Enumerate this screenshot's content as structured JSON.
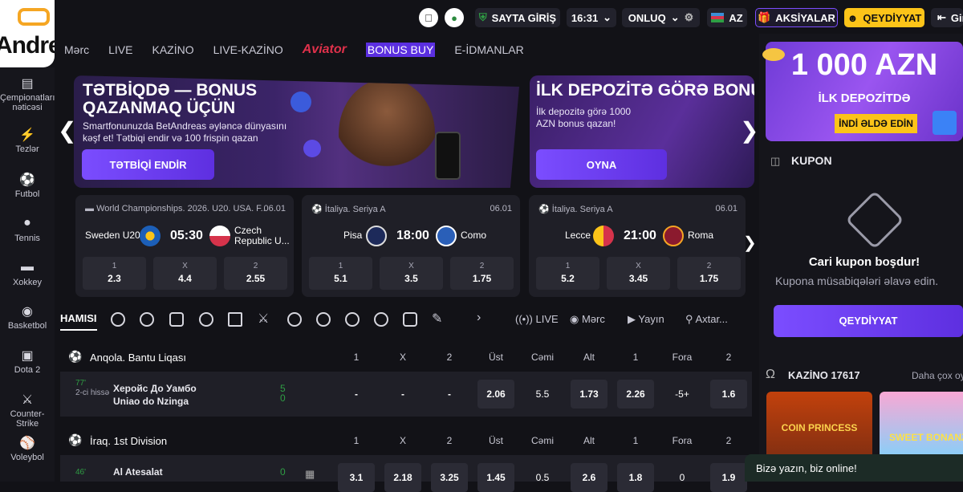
{
  "header": {
    "login": "SAYTA GİRİŞ",
    "time": "16:31",
    "odds_format": "ONLUQ",
    "language": "AZ",
    "promotions": "AKSİYALAR",
    "register": "QEYDİYYAT",
    "exit": "Giriş"
  },
  "logo": {
    "text": "Andreas"
  },
  "nav": [
    "Mərc",
    "LIVE",
    "KAZİNO",
    "LIVE-KAZİNO",
    "Aviator",
    "BONUS BUY",
    "E-İDMANLAR"
  ],
  "sidebar": [
    {
      "label": "Çempionatların nəticəsi",
      "icon": "results-icon"
    },
    {
      "label": "Tezlər",
      "icon": "lightning-icon"
    },
    {
      "label": "Futbol",
      "icon": "soccer-icon"
    },
    {
      "label": "Tennis",
      "icon": "tennis-icon"
    },
    {
      "label": "Xokkey",
      "icon": "hockey-icon"
    },
    {
      "label": "Basketbol",
      "icon": "basketball-icon"
    },
    {
      "label": "Dota 2",
      "icon": "dota-icon"
    },
    {
      "label": "Counter-Strike",
      "icon": "cs-icon"
    },
    {
      "label": "Voleybol",
      "icon": "volleyball-icon"
    }
  ],
  "banners": [
    {
      "title": "TƏTBİQDƏ — BONUS QAZANMAQ ÜÇÜN",
      "desc": "Smartfonunuzda BetAndreas əyləncə dünyasını kəşf et! Tətbiqi endir və 100 frispin qazan",
      "button": "TƏTBİQİ ENDİR"
    },
    {
      "title": "İLK DEPOZİTƏ GÖRƏ BONUS",
      "desc": "İlk depozitə görə 1000 AZN bonus qazan!",
      "button": "OYNA"
    }
  ],
  "matches": [
    {
      "league": "World Championships. 2026. U20. USA. F...",
      "date": "06.01",
      "home": "Sweden U20",
      "away": "Czech Republic U...",
      "time": "05:30",
      "odds": [
        {
          "label": "1",
          "value": "2.3"
        },
        {
          "label": "X",
          "value": "4.4"
        },
        {
          "label": "2",
          "value": "2.55"
        }
      ]
    },
    {
      "league": "İtaliya. Seriya A",
      "date": "06.01",
      "home": "Pisa",
      "away": "Como",
      "time": "18:00",
      "odds": [
        {
          "label": "1",
          "value": "5.1"
        },
        {
          "label": "X",
          "value": "3.5"
        },
        {
          "label": "2",
          "value": "1.75"
        }
      ]
    },
    {
      "league": "İtaliya. Seriya A",
      "date": "06.01",
      "home": "Lecce",
      "away": "Roma",
      "time": "21:00",
      "odds": [
        {
          "label": "1",
          "value": "5.2"
        },
        {
          "label": "X",
          "value": "3.45"
        },
        {
          "label": "2",
          "value": "1.75"
        }
      ]
    }
  ],
  "sportbar": {
    "all": "HAMISI",
    "live": "LIVE",
    "bet": "Mərc",
    "stream": "Yayın",
    "search": "Axtar..."
  },
  "columns": [
    "1",
    "X",
    "2",
    "Üst",
    "Cəmi",
    "Alt",
    "1",
    "Fora",
    "2"
  ],
  "leagues": [
    {
      "name": "Anqola. Bantu Liqası",
      "minute": "77'",
      "period": "2-ci hissə",
      "home": "Херойс До Уамбо",
      "away": "Uniao do Nzinga",
      "score_home": "5",
      "score_away": "0",
      "cells": [
        "-",
        "-",
        "-",
        "2.06",
        "5.5",
        "1.73",
        "2.26",
        "-5+",
        "1.6"
      ]
    },
    {
      "name": "İraq. 1st Division",
      "minute": "46'",
      "period": "",
      "home": "Al Atesalat",
      "away": "",
      "score_home": "0",
      "score_away": "0",
      "cells": [
        "3.1",
        "2.18",
        "3.25",
        "1.45",
        "0.5",
        "2.6",
        "1.8",
        "0",
        "1.9"
      ]
    }
  ],
  "promo": {
    "amount": "1 000 AZN",
    "sub": "İLK DEPOZİTDƏ",
    "button": "İNDİ ƏLDƏ EDİN"
  },
  "coupon": {
    "title": "KUPON",
    "empty_title": "Cari kupon boşdur!",
    "empty_desc": "Kupona müsabiqələri əlavə edin.",
    "register": "QEYDİYYAT"
  },
  "casino": {
    "title": "KAZİNO 17617",
    "more": "Daha çox oyun",
    "games": [
      "COIN PRINCESS",
      "SWEET BONANZA"
    ]
  },
  "chat": {
    "text": "Bizə yazın, biz online!"
  }
}
